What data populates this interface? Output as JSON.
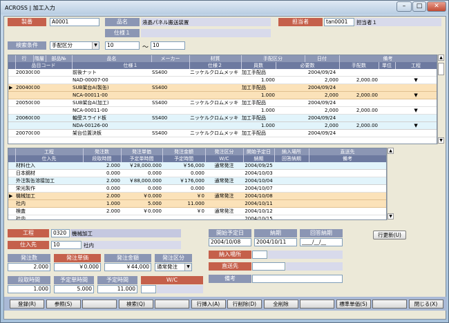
{
  "window": {
    "title": "ACROSS | 加工入力",
    "min": "–",
    "max": "□",
    "close": "✕"
  },
  "header": {
    "seiban_label": "製番",
    "seiban_value": "A0001",
    "hinmei_label": "品名",
    "hinmei_value": "液晶パネル搬送装置",
    "shiyou_label": "仕様１",
    "tanto_label": "担当者",
    "tanto_code": "tan0001",
    "tanto_name": "担当者１",
    "kensaku_label": "検索条件",
    "kensaku_select": "手配区分",
    "range_from": "10",
    "range_sep": "～",
    "range_to": "10"
  },
  "top_grid": {
    "header1": [
      "行",
      "階層",
      "部品№",
      "品名",
      "メーカー",
      "材質",
      "手配区分",
      "日付",
      "備考"
    ],
    "header2": [
      "品目コード",
      "仕様１",
      "仕様２",
      "員数",
      "必要数",
      "手配数",
      "単位",
      "工程"
    ],
    "rows": [
      {
        "gyo": "200300",
        "kaiso": "00",
        "name": "前後ナット",
        "maker": "SS400",
        "zai": "ニッケルクロムメッキ",
        "tehai": "加工手配品",
        "date": "2004/09/24",
        "code": "NAD-00007-00",
        "insu": "1.000",
        "hitsuyo": "2,000",
        "tehaisu": "2,000.00",
        "kotei": "▼",
        "style": "gb",
        "ptr": ""
      },
      {
        "gyo": "200400",
        "kaiso": "00",
        "name": "SUB架台A(製缶)",
        "maker": "SS400",
        "zai": "",
        "tehai": "加工手配品",
        "date": "2004/09/24",
        "code": "NCA-00011-00",
        "insu": "1.000",
        "hitsuyo": "2,000",
        "tehaisu": "2,000.00",
        "kotei": "▼",
        "style": "go",
        "ptr": "▶"
      },
      {
        "gyo": "200500",
        "kaiso": "00",
        "name": "SUB架台A(加工)",
        "maker": "SS400",
        "zai": "ニッケルクロムメッキ",
        "tehai": "加工手配品",
        "date": "2004/09/24",
        "code": "NCA-00011-00",
        "insu": "1.000",
        "hitsuyo": "2,000",
        "tehaisu": "2,000.00",
        "kotei": "▼",
        "style": "gb",
        "ptr": ""
      },
      {
        "gyo": "200600",
        "kaiso": "00",
        "name": "軸受スライド板",
        "maker": "SS400",
        "zai": "ニッケルクロムメッキ",
        "tehai": "加工手配品",
        "date": "2004/09/24",
        "code": "NDA-00126-00",
        "insu": "1.000",
        "hitsuyo": "2,000",
        "tehaisu": "2,000.00",
        "kotei": "▼",
        "style": "gc",
        "ptr": ""
      },
      {
        "gyo": "200700",
        "kaiso": "00",
        "name": "架台位置決板",
        "maker": "SS400",
        "zai": "ニッケルクロムメッキ",
        "tehai": "加工手配品",
        "date": "2004/09/24",
        "code": "",
        "insu": "",
        "hitsuyo": "",
        "tehaisu": "",
        "kotei": "",
        "style": "gb",
        "ptr": ""
      }
    ]
  },
  "bottom_grid": {
    "header1": [
      "工程",
      "発注数",
      "発注単価",
      "発注金額",
      "発注区分",
      "開始予定日",
      "納入場所",
      "直送先"
    ],
    "header2": [
      "仕入先",
      "段取時間",
      "予定単時間",
      "予定時間",
      "W/C",
      "納期",
      "回答納期",
      "備考"
    ],
    "rows": [
      {
        "a": "材料仕入",
        "b": "2.000",
        "c": "￥28,000.000",
        "d": "￥56,000",
        "e": "通常発注",
        "f": "2004/09/25",
        "g": "",
        "h": "",
        "style": "gc"
      },
      {
        "a": "日本鋼材",
        "b": "0.000",
        "c": "0.000",
        "d": "0.000",
        "e": "",
        "f": "2004/10/03",
        "g": "",
        "h": "",
        "style": "gb"
      },
      {
        "a": "外注製缶溶接加工",
        "b": "2.000",
        "c": "￥88,000.000",
        "d": "￥176,000",
        "e": "通常発注",
        "f": "2004/10/04",
        "g": "",
        "h": "",
        "style": "gc"
      },
      {
        "a": "栄光製作",
        "b": "0.000",
        "c": "0.000",
        "d": "0.000",
        "e": "",
        "f": "2004/10/07",
        "g": "",
        "h": "",
        "style": "gb"
      },
      {
        "a": "機械加工",
        "b": "2.000",
        "c": "￥0.000",
        "d": "￥0",
        "e": "通常発注",
        "f": "2004/10/08",
        "g": "",
        "h": "",
        "style": "go"
      },
      {
        "a": "社内",
        "b": "1.000",
        "c": "5.000",
        "d": "11.000",
        "e": "",
        "f": "2004/10/11",
        "g": "",
        "h": "",
        "style": "go"
      },
      {
        "a": "検査",
        "b": "2.000",
        "c": "￥0.000",
        "d": "￥0",
        "e": "通常発注",
        "f": "2004/10/12",
        "g": "",
        "h": "",
        "style": "gb"
      },
      {
        "a": "社内",
        "b": "",
        "c": "",
        "d": "",
        "e": "",
        "f": "2004/10/15",
        "g": "",
        "h": "",
        "style": "gb"
      }
    ]
  },
  "detail": {
    "kotei_label": "工程",
    "kotei_code": "0320",
    "kotei_name": "機械加工",
    "shiire_label": "仕入先",
    "shiire_code": "10",
    "shiire_name": "社内",
    "kaishi_label": "開始予定日",
    "kaishi_value": "2004/10/08",
    "noki_label": "納期",
    "noki_value": "2004/10/11",
    "kaito_label": "回答納期",
    "kaito_value": "____/__/__",
    "update_button": "行更新(U)",
    "nonyu_label": "納入場所",
    "chokuso_label": "直送先",
    "biko_label": "備考",
    "hachusu_label": "発注数",
    "hachusu_value": "2.000",
    "tanka_label": "発注単価",
    "tanka_value": "￥0.000",
    "kingaku_label": "発注金額",
    "kingaku_value": "￥44,000",
    "kubun_label": "発注区分",
    "kubun_value": "通常発注",
    "dandori_label": "段取時間",
    "dandori_value": "1.000",
    "yotei_tan_label": "予定単時間",
    "yotei_tan_value": "5.000",
    "yotei_label": "予定時間",
    "yotei_value": "11.000",
    "wc_label": "W/C"
  },
  "footer": [
    "登録(R)",
    "参照(S)",
    "",
    "検索(Q)",
    "",
    "行挿入(A)",
    "行削除(D)",
    "全削除",
    "",
    "標準単価(S)",
    "",
    "閉じる(X)"
  ]
}
